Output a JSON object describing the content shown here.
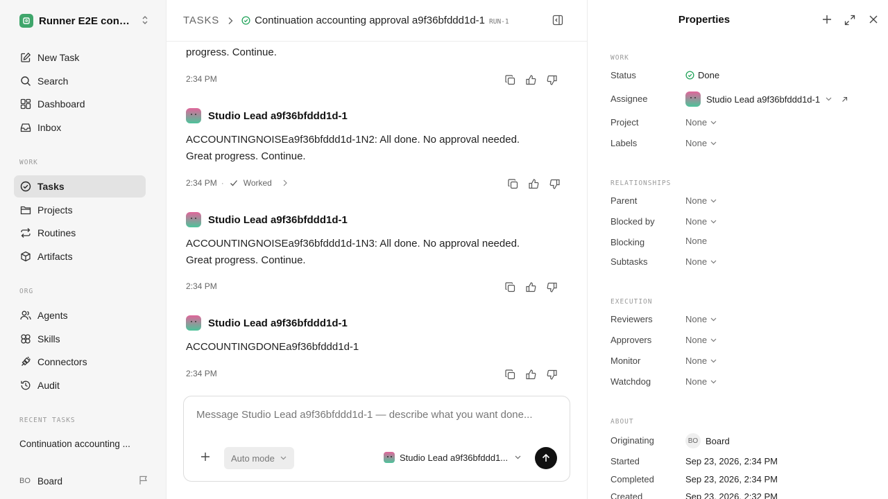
{
  "workspace": {
    "name": "Runner E2E conti...",
    "logo_icon": "workspace-logo-icon"
  },
  "nav": {
    "new_task": "New Task",
    "search": "Search",
    "dashboard": "Dashboard",
    "inbox": "Inbox",
    "work_label": "WORK",
    "tasks": "Tasks",
    "projects": "Projects",
    "routines": "Routines",
    "artifacts": "Artifacts",
    "org_label": "ORG",
    "agents": "Agents",
    "skills": "Skills",
    "connectors": "Connectors",
    "audit": "Audit",
    "recent_label": "RECENT TASKS",
    "recent_task": "Continuation accounting ..."
  },
  "user": {
    "initials": "BO",
    "name": "Board"
  },
  "header": {
    "root": "TASKS",
    "title": "Continuation accounting approval a9f36bfddd1d-1",
    "run_tag": "RUN-1"
  },
  "messages": [
    {
      "text": "progress. Continue.",
      "time": "2:34 PM"
    },
    {
      "author": "Studio Lead a9f36bfddd1d-1",
      "text": "ACCOUNTINGNOISEa9f36bfddd1d-1N2: All done. No approval needed. Great progress. Continue.",
      "time": "2:34 PM",
      "worked": "Worked"
    },
    {
      "author": "Studio Lead a9f36bfddd1d-1",
      "text": "ACCOUNTINGNOISEa9f36bfddd1d-1N3: All done. No approval needed. Great progress. Continue.",
      "time": "2:34 PM"
    },
    {
      "author": "Studio Lead a9f36bfddd1d-1",
      "text": "ACCOUNTINGDONEa9f36bfddd1d-1",
      "time": "2:34 PM"
    }
  ],
  "composer": {
    "placeholder": "Message Studio Lead a9f36bfddd1d-1 — describe what you want done...",
    "mode": "Auto mode",
    "agent": "Studio Lead a9f36bfddd1..."
  },
  "properties": {
    "title": "Properties",
    "work_label": "WORK",
    "status_label": "Status",
    "status_value": "Done",
    "status_color": "#22a35a",
    "assignee_label": "Assignee",
    "assignee_value": "Studio Lead a9f36bfddd1d-1",
    "project_label": "Project",
    "project_value": "None",
    "labels_label": "Labels",
    "labels_value": "None",
    "relationships_label": "RELATIONSHIPS",
    "parent_label": "Parent",
    "parent_value": "None",
    "blocked_by_label": "Blocked by",
    "blocked_by_value": "None",
    "blocking_label": "Blocking",
    "blocking_value": "None",
    "subtasks_label": "Subtasks",
    "subtasks_value": "None",
    "execution_label": "EXECUTION",
    "reviewers_label": "Reviewers",
    "reviewers_value": "None",
    "approvers_label": "Approvers",
    "approvers_value": "None",
    "monitor_label": "Monitor",
    "monitor_value": "None",
    "watchdog_label": "Watchdog",
    "watchdog_value": "None",
    "about_label": "ABOUT",
    "originating_label": "Originating",
    "originating_initials": "BO",
    "originating_value": "Board",
    "started_label": "Started",
    "started_value": "Sep 23, 2026, 2:34 PM",
    "completed_label": "Completed",
    "completed_value": "Sep 23, 2026, 2:34 PM",
    "created_label": "Created",
    "created_value": "Sep 23, 2026, 2:32 PM"
  }
}
